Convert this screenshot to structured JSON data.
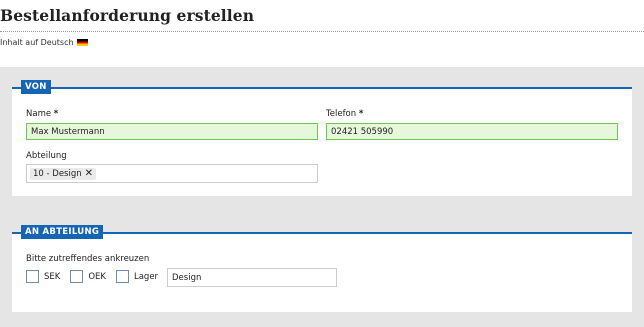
{
  "page": {
    "title": "Bestellanforderung erstellen",
    "language_note": "Inhalt auf Deutsch",
    "language_flag_icon": "german-flag-icon"
  },
  "colors": {
    "accent": "#1665b4",
    "valid_bg": "#e6f7dc",
    "valid_border": "#6dc94e"
  },
  "von": {
    "legend": "VON",
    "name_label": "Name",
    "name_required": "*",
    "name_value": "Max Mustermann",
    "phone_label": "Telefon",
    "phone_required": "*",
    "phone_value": "02421 505990",
    "dept_label": "Abteilung",
    "dept_tag": "10 - Design",
    "dept_tag_remove": "✕"
  },
  "an_abteilung": {
    "legend": "AN ABTEILUNG",
    "instruction": "Bitte zutreffendes ankreuzen",
    "options": [
      {
        "label": "SEK",
        "checked": false
      },
      {
        "label": "OEK",
        "checked": false
      },
      {
        "label": "Lager",
        "checked": false
      }
    ],
    "text_value": "Design"
  }
}
